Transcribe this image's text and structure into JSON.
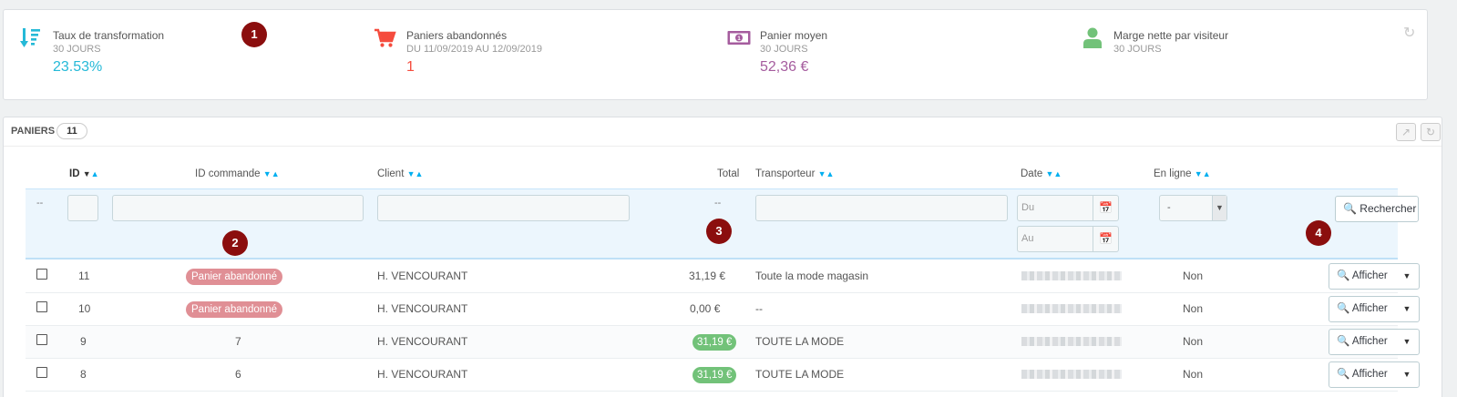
{
  "kpis": [
    {
      "title": "Taux de transformation",
      "sub": "30 JOURS",
      "value": "23.53%",
      "color": "#25b9d7",
      "icon": "sort-down-icon"
    },
    {
      "title": "Paniers abandonnés",
      "sub": "DU 11/09/2019 AU 12/09/2019",
      "value": "1",
      "color": "#f54c3e",
      "icon": "cart-icon"
    },
    {
      "title": "Panier moyen",
      "sub": "30 JOURS",
      "value": "52,36 €",
      "color": "#a55c9e",
      "icon": "money-icon"
    },
    {
      "title": "Marge nette par visiteur",
      "sub": "30 JOURS",
      "value": "",
      "color": "#72c279",
      "icon": "user-icon"
    }
  ],
  "markers": [
    "1",
    "2",
    "3",
    "4"
  ],
  "carts": {
    "title": "PANIERS",
    "count": "11",
    "columns": {
      "id": "ID",
      "order_id": "ID commande",
      "client": "Client",
      "total": "Total",
      "carrier": "Transporteur",
      "date": "Date",
      "online": "En ligne"
    },
    "filters": {
      "bulk_placeholder": "--",
      "total_placeholder": "--",
      "date_from": "Du",
      "date_to": "Au",
      "online_selected": "-",
      "search_label": "Rechercher"
    },
    "rows": [
      {
        "id": "11",
        "order": "Panier abandonné",
        "order_abandoned": true,
        "client": "H. VENCOURANT",
        "total": "31,19 €",
        "total_paid": false,
        "carrier": "Toute la mode magasin",
        "online": "Non",
        "action": "Afficher"
      },
      {
        "id": "10",
        "order": "Panier abandonné",
        "order_abandoned": true,
        "client": "H. VENCOURANT",
        "total": "0,00 €",
        "total_paid": false,
        "carrier": "--",
        "online": "Non",
        "action": "Afficher"
      },
      {
        "id": "9",
        "order": "7",
        "order_abandoned": false,
        "client": "H. VENCOURANT",
        "total": "31,19 €",
        "total_paid": true,
        "carrier": "TOUTE LA MODE",
        "online": "Non",
        "action": "Afficher"
      },
      {
        "id": "8",
        "order": "6",
        "order_abandoned": false,
        "client": "H. VENCOURANT",
        "total": "31,19 €",
        "total_paid": true,
        "carrier": "TOUTE LA MODE",
        "online": "Non",
        "action": "Afficher"
      }
    ]
  }
}
